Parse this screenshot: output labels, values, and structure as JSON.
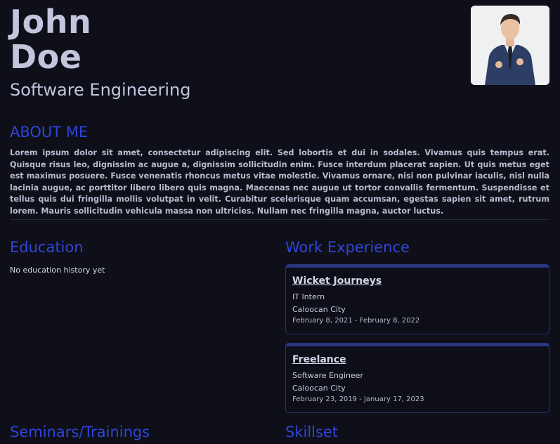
{
  "profile": {
    "first_name": "John",
    "last_name": "Doe",
    "title": "Software Engineering"
  },
  "about": {
    "heading": "ABOUT ME",
    "text": "Lorem ipsum dolor sit amet, consectetur adipiscing elit. Sed lobortis et dui in sodales. Vivamus quis tempus erat. Quisque risus leo, dignissim ac augue a, dignissim sollicitudin enim. Fusce interdum placerat sapien. Ut quis metus eget est maximus posuere. Fusce venenatis rhoncus metus vitae molestie. Vivamus ornare, nisi non pulvinar iaculis, nisl nulla lacinia augue, ac porttitor libero libero quis magna. Maecenas nec augue ut tortor convallis fermentum. Suspendisse et tellus quis dui fringilla mollis volutpat in velit. Curabitur scelerisque quam accumsan, egestas sapien sit amet, rutrum lorem. Mauris sollicitudin vehicula massa non ultricies. Nullam nec fringilla magna, auctor luctus."
  },
  "education": {
    "heading": "Education",
    "empty_text": "No education history yet"
  },
  "work": {
    "heading": "Work Experience",
    "items": [
      {
        "company": "Wicket Journeys",
        "role": "IT Intern",
        "location": "Caloocan City",
        "dates": "February 8, 2021 - February 8, 2022"
      },
      {
        "company": "Freelance",
        "role": "Software Engineer",
        "location": "Caloocan City",
        "dates": "February 23, 2019 - January 17, 2023"
      }
    ]
  },
  "seminars": {
    "heading": "Seminars/Trainings"
  },
  "skills": {
    "heading": "Skillset"
  },
  "colors": {
    "background": "#0e0f19",
    "accent": "#2f46d6",
    "text": "#c3c5dd"
  }
}
